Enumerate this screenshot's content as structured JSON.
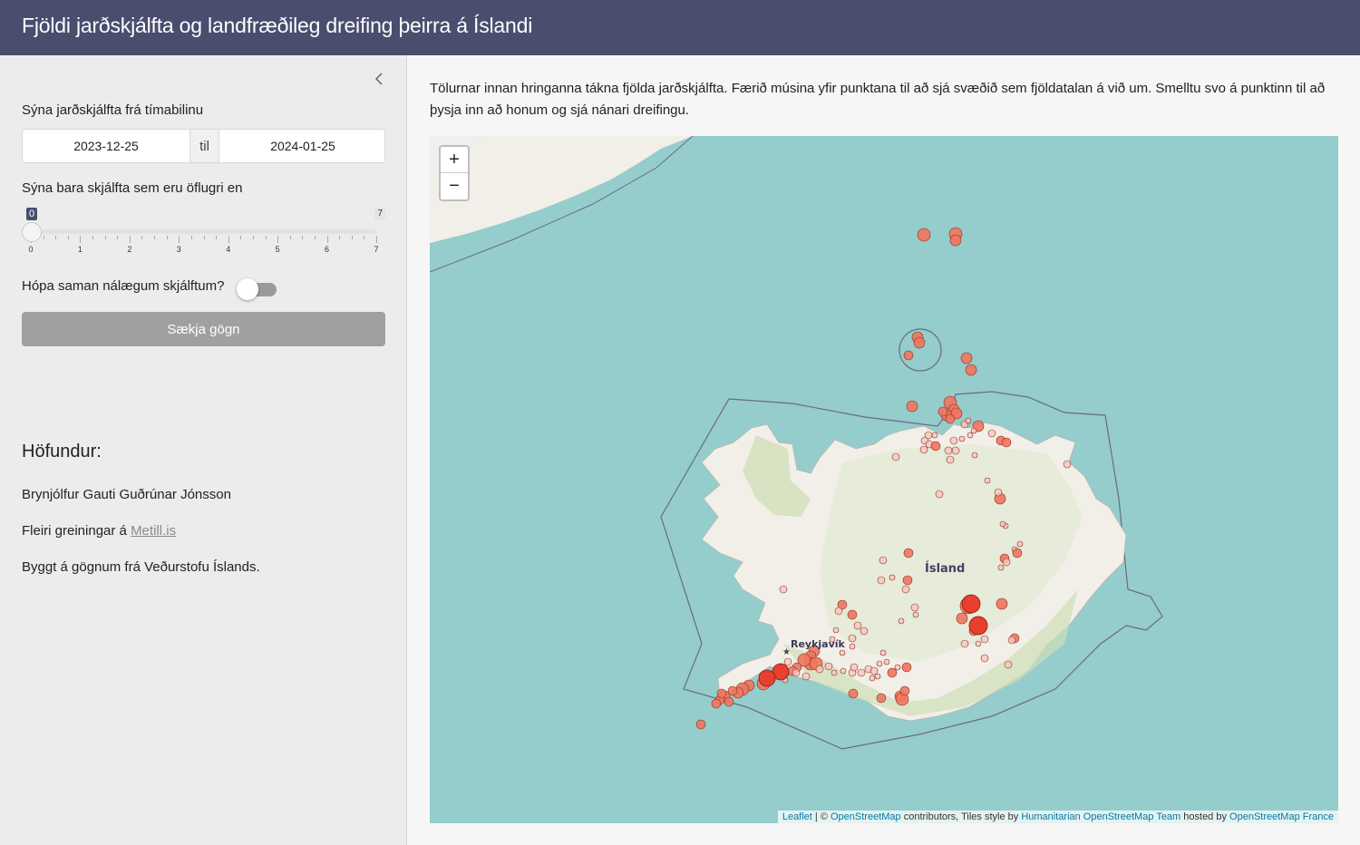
{
  "header": {
    "title": "Fjöldi jarðskjálfta og landfræðileg dreifing þeirra á Íslandi"
  },
  "sidebar": {
    "date_label": "Sýna jarðskjálfta frá tímabilinu",
    "date_start": "2023-12-25",
    "date_sep": "til",
    "date_end": "2024-01-25",
    "magnitude_label": "Sýna bara skjálfta sem eru öflugri en",
    "slider": {
      "min": 0,
      "max": 7,
      "value": 0,
      "ticks": [
        "0",
        "1",
        "2",
        "3",
        "4",
        "5",
        "6",
        "7"
      ],
      "min_tag": "0",
      "max_tag": "7"
    },
    "group_label": "Hópa saman nálægum skjálftum?",
    "group_enabled": false,
    "fetch_label": "Sækja gögn",
    "author_heading": "Höfundur:",
    "author_name": "Brynjólfur Gauti Guðrúnar Jónsson",
    "more_prefix": "Fleiri greiningar á ",
    "more_link": "Metill.is",
    "source_text": "Byggt á gögnum frá Veðurstofu Íslands."
  },
  "main": {
    "intro": "Tölurnar innan hringanna tákna fjölda jarðskjálfta. Færið músina yfir punktana til að sjá svæðið sem fjöldatalan á við um. Smelltu svo á punktinn til að þysja inn að honum og sjá nánari dreifingu."
  },
  "map": {
    "zoom_in": "+",
    "zoom_out": "−",
    "country_label": "Ísland",
    "city_label": "Reykjavík",
    "attribution": {
      "leaflet": "Leaflet",
      "sep": " | © ",
      "osm": "OpenStreetMap",
      "contrib": " contributors, Tiles style by ",
      "hot": "Humanitarian OpenStreetMap Team",
      "hosted": " hosted by ",
      "osmfr": "OpenStreetMap France"
    },
    "colors": {
      "sea": "#94cdcc",
      "land": "#f2efe9",
      "highland": "#cfe0b8",
      "quake": "#f0755f",
      "quake_big": "#e8402d"
    }
  }
}
